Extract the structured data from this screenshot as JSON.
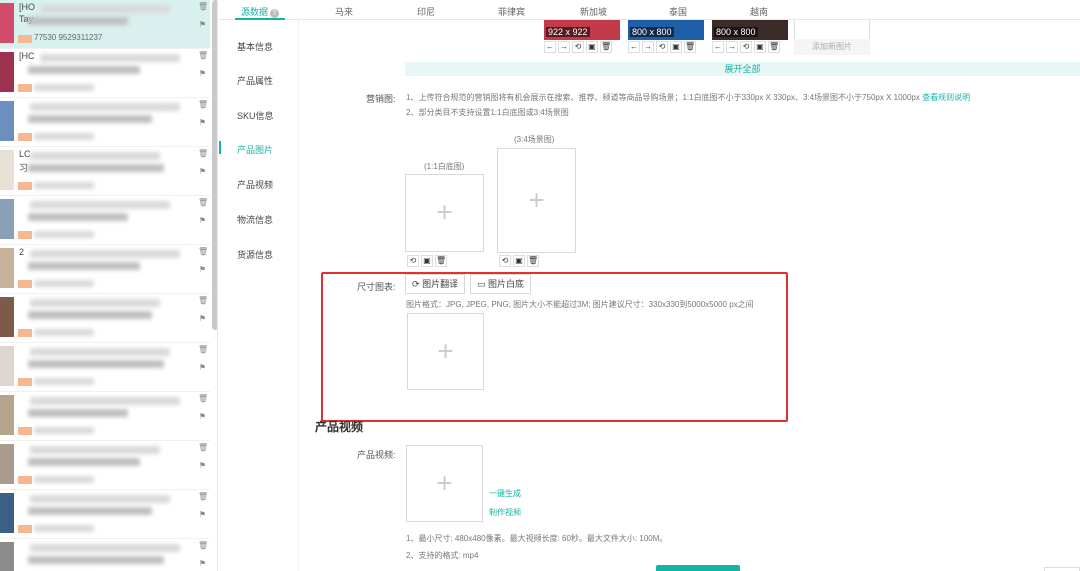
{
  "tabs": [
    {
      "label": "源数据"
    },
    {
      "label": "马来"
    },
    {
      "label": "印尼"
    },
    {
      "label": "菲律宾"
    },
    {
      "label": "新加坡"
    },
    {
      "label": "泰国"
    },
    {
      "label": "越南"
    }
  ],
  "sidenav": [
    {
      "label": "基本信息"
    },
    {
      "label": "产品属性"
    },
    {
      "label": "SKU信息"
    },
    {
      "label": "产品图片"
    },
    {
      "label": "产品视频"
    },
    {
      "label": "物流信息"
    },
    {
      "label": "货源信息"
    }
  ],
  "list": {
    "items": [
      {
        "title": "[HO",
        "sub": "Tay",
        "meta": "77530 9529311237"
      },
      {
        "title": "[HC",
        "sub": "",
        "meta": ""
      },
      {
        "title": "",
        "sub": "",
        "meta": ""
      },
      {
        "title": "LC",
        "sub": "习",
        "meta": ""
      },
      {
        "title": "",
        "sub": "",
        "meta": ""
      },
      {
        "title": "2",
        "sub": "",
        "meta": ""
      },
      {
        "title": "",
        "sub": "",
        "meta": ""
      },
      {
        "title": "",
        "sub": "",
        "meta": ""
      },
      {
        "title": "",
        "sub": "",
        "meta": ""
      },
      {
        "title": "",
        "sub": "",
        "meta": ""
      },
      {
        "title": "",
        "sub": "",
        "meta": ""
      },
      {
        "title": "",
        "sub": "",
        "meta": ""
      }
    ]
  },
  "gallery": {
    "images": [
      {
        "size": "922 x 922",
        "color": "#c23a4a"
      },
      {
        "size": "800 x 800",
        "color": "#1f5fa8"
      },
      {
        "size": "800 x 800",
        "color": "#3a2a28"
      }
    ],
    "add_new": "添加新图片",
    "expand_all": "展开全部"
  },
  "marketing": {
    "label": "营销图:",
    "note1": "1、上传符合规范的营销图将有机会展示在搜索、推荐、频道等商品导购场景；1:1白底图不小于330px X 330px、3:4场景图不小于750px X 1000px",
    "rule_link": "查看规则说明",
    "note2": "2、部分类目不支持设置1:1白底图或3:4场景图",
    "box1_label": "(1:1白底图)",
    "box2_label": "(3:4场景图)"
  },
  "size_chart": {
    "label": "尺寸图表:",
    "translate_btn": "图片翻译",
    "white_bg_btn": "图片白底",
    "note": "图片格式：JPG, JPEG, PNG; 图片大小不能超过3M; 图片建议尺寸：330x330到5000x5000 px之间"
  },
  "video": {
    "section_title": "产品视频",
    "label": "产品视频:",
    "gen_link": "一键生成",
    "make_link": "制作视频",
    "note1": "1、最小尺寸: 480x480像素。最大视频长度: 60秒。最大文件大小: 100M。",
    "note2": "2、支持的格式: mp4"
  },
  "colors": {
    "accent": "#14b3a8",
    "highlight": "#e03030"
  }
}
